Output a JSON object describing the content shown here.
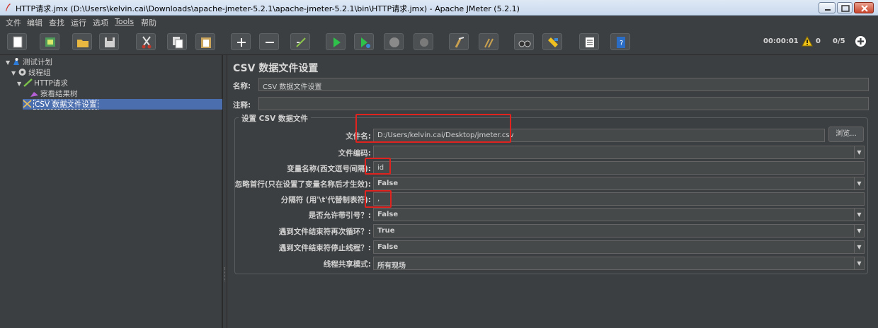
{
  "window": {
    "title": "HTTP请求.jmx (D:\\Users\\kelvin.cai\\Downloads\\apache-jmeter-5.2.1\\apache-jmeter-5.2.1\\bin\\HTTP请求.jmx) - Apache JMeter (5.2.1)"
  },
  "menu": [
    "文件",
    "编辑",
    "查找",
    "运行",
    "选项",
    "Tools",
    "帮助"
  ],
  "toolbar": {
    "buttons": [
      "new-icon",
      "templates-icon",
      "open-icon",
      "save-icon",
      "cut-icon",
      "copy-icon",
      "paste-icon",
      "expand-icon",
      "collapse-icon",
      "toggle-icon",
      "start-icon",
      "start-no-pause-icon",
      "stop-icon",
      "shutdown-icon",
      "clear-icon",
      "clear-all-icon",
      "search-icon",
      "reset-search-icon",
      "function-helper-icon",
      "help-icon"
    ],
    "elapsed": "00:00:01",
    "warnings": "0",
    "threads": "0/5"
  },
  "tree": {
    "items": [
      {
        "label": "测试计划",
        "icon": "test-plan-icon"
      },
      {
        "label": "线程组",
        "icon": "thread-group-icon"
      },
      {
        "label": "HTTP请求",
        "icon": "http-sampler-icon"
      },
      {
        "label": "察看结果树",
        "icon": "results-tree-icon"
      },
      {
        "label": "CSV 数据文件设置",
        "icon": "csv-config-icon"
      }
    ]
  },
  "panel": {
    "title": "CSV 数据文件设置",
    "name_label": "名称:",
    "name_value": "CSV 数据文件设置",
    "comment_label": "注释:",
    "comment_value": "",
    "group_title": "设置 CSV 数据文件",
    "filename_label": "文件名:",
    "filename_value": "D:/Users/kelvin.cai/Desktop/jmeter.csv",
    "browse_label": "浏览...",
    "encoding_label": "文件编码:",
    "encoding_value": "",
    "varnames_label": "变量名称(西文逗号间隔):",
    "varnames_value": "id",
    "ignore_first_label": "忽略首行(只在设置了变量名称后才生效):",
    "ignore_first_value": "False",
    "delimiter_label": "分隔符 (用'\\t'代替制表符):",
    "delimiter_value": ",",
    "quoted_label": "是否允许带引号？:",
    "quoted_value": "False",
    "recycle_label": "遇到文件结束符再次循环？:",
    "recycle_value": "True",
    "stop_label": "遇到文件结束符停止线程？:",
    "stop_value": "False",
    "share_label": "线程共享模式:",
    "share_value": "所有现场"
  },
  "colors": {
    "background": "#3c3f41",
    "selection": "#4b6eaf",
    "highlight": "#e0231f"
  }
}
